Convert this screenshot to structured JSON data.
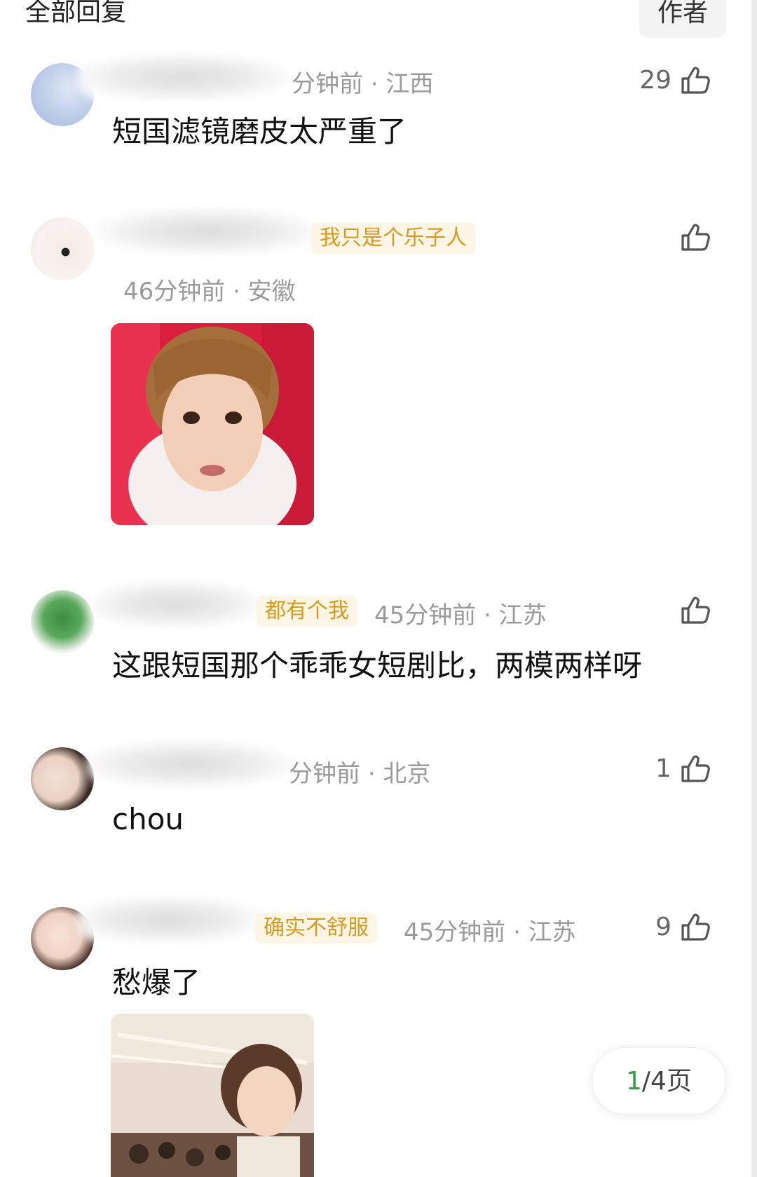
{
  "header": {
    "title": "全部回复",
    "author_tab": "作者"
  },
  "comments": [
    {
      "meta": "分钟前 · 江西",
      "content": "短国滤镜磨皮太严重了",
      "likes": "29"
    },
    {
      "badge": "我只是个乐子人",
      "meta": "46分钟前 · 安徽",
      "likes": ""
    },
    {
      "badge": "都有个我",
      "meta": "45分钟前 · 江苏",
      "content": "这跟短国那个乖乖女短剧比，两模两样呀",
      "likes": ""
    },
    {
      "meta": "分钟前 · 北京",
      "content": "chou",
      "likes": "1"
    },
    {
      "badge": "确实不舒服",
      "meta": "45分钟前 · 江苏",
      "content": "愁爆了",
      "likes": "9"
    }
  ],
  "pager": {
    "current": "1",
    "total_text": "/4页"
  },
  "colors": {
    "badge_text": "#d89a1e",
    "badge_bg": "#fdf6e6",
    "meta": "#9a9a9a",
    "pager_current": "#2fa04a"
  }
}
